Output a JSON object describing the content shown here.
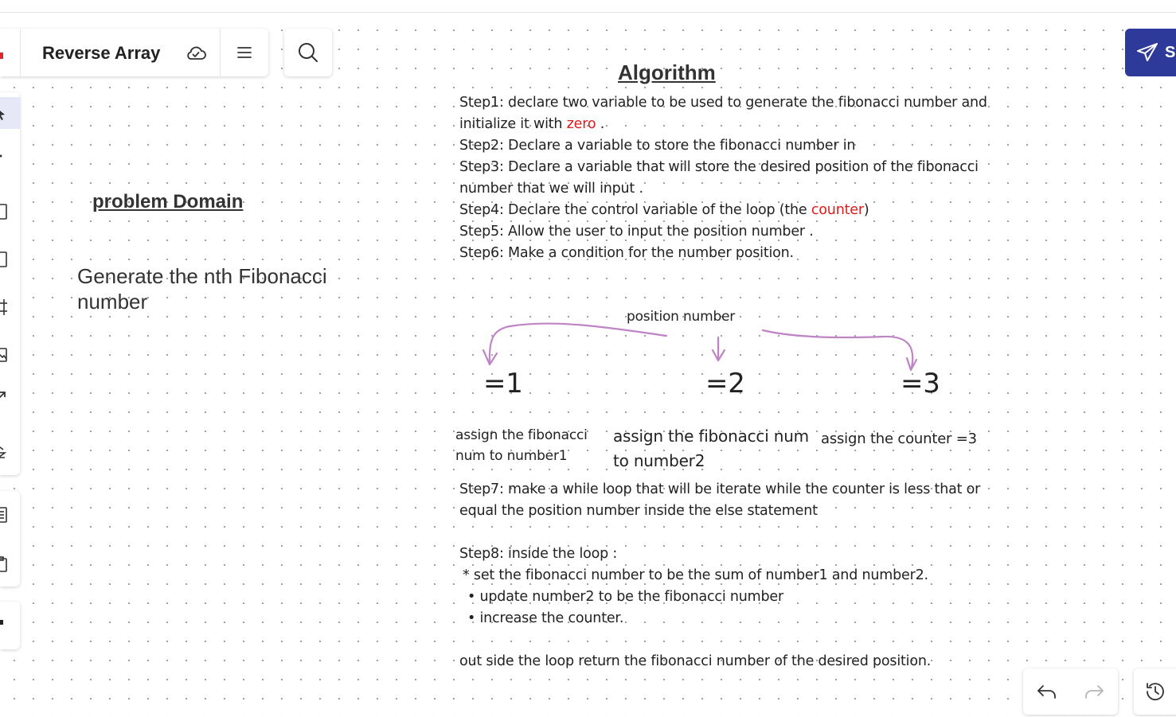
{
  "board": {
    "title": "Reverse Array"
  },
  "share": {
    "label": "S"
  },
  "problem": {
    "heading": "problem Domain",
    "text": "Generate the nth Fibonacci number"
  },
  "algorithm": {
    "heading": "Algorithm",
    "step1a": "Step1: declare two variable to be used to generate the fibonacci number and",
    "step1b_pre": "initialize it with ",
    "step1b_red": "zero",
    "step1b_post": " .",
    "step2": "Step2: Declare a variable to store the fibonacci number in",
    "step3a": "Step3: Declare a variable that will store the desired position of the fibonacci",
    "step3b": "number that we will input .",
    "step4_pre": "Step4: Declare the control variable of the loop (the ",
    "step4_red": "counter",
    "step4_post": ")",
    "step5": "Step5: Allow the user to input the position number .",
    "step6": "Step6: Make a condition for the number position."
  },
  "diagram": {
    "position_label": "position number",
    "branches": [
      {
        "value": "=1",
        "note_line1": "assign the fibonacci",
        "note_line2": "num to number1"
      },
      {
        "value": "=2",
        "note_line1": "assign the fibonacci num",
        "note_line2": "to number2"
      },
      {
        "value": "=3",
        "note_line1": "assign the counter =3"
      }
    ]
  },
  "algorithm_cont": {
    "step7a": "Step7: make a while loop that will be iterate while the counter is less that or",
    "step7b": "equal the position number inside the else statement",
    "step8": "Step8: inside the loop :",
    "bullet1": "* set the fibonacci number to be the sum of number1 and number2.",
    "bullet2": "• update number2 to be the fibonacci number",
    "bullet3": "•  increase the counter.",
    "final": "out side the loop return the fibonacci number of the desired position."
  },
  "colors": {
    "accent": "#2d3a9a",
    "highlight_red": "#e01b1b",
    "arrow_purple": "#c084c6",
    "logo_red": "#e0262b"
  },
  "icons": {
    "cloud": "cloud-sync-icon",
    "menu": "hamburger-menu-icon",
    "search": "search-icon",
    "share": "paper-plane-icon",
    "undo": "undo-icon",
    "redo": "redo-icon",
    "history": "history-icon"
  }
}
